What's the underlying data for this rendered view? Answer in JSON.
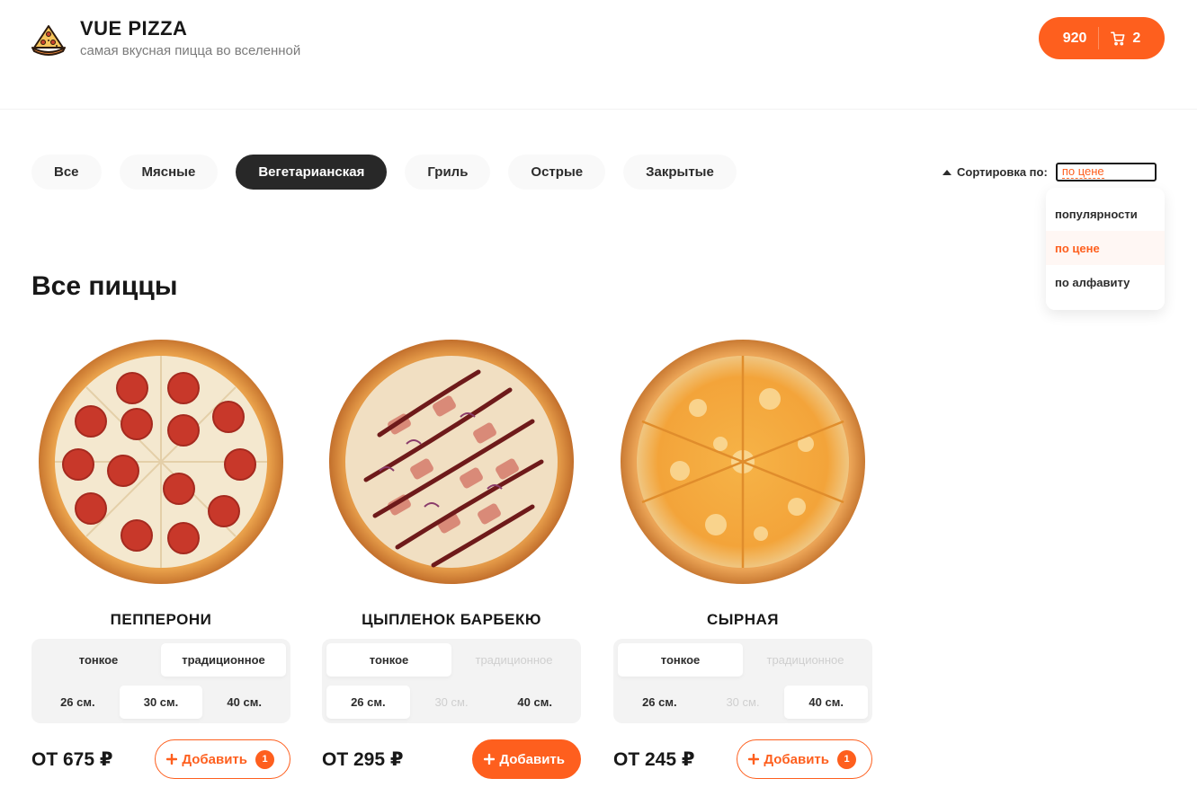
{
  "header": {
    "title": "VUE PIZZA",
    "subtitle": "самая вкусная пицца во вселенной",
    "cart": {
      "sum": "920",
      "count": "2"
    }
  },
  "categories": [
    "Все",
    "Мясные",
    "Вегетарианская",
    "Гриль",
    "Острые",
    "Закрытые"
  ],
  "active_category": "Вегетарианская",
  "sort": {
    "label": "Сортировка по:",
    "value": "по цене",
    "options": [
      "популярности",
      "по цене",
      "по алфавиту"
    ]
  },
  "section_title": "Все пиццы",
  "pizzas": [
    {
      "name": "ПЕППЕРОНИ",
      "types": [
        "тонкое",
        "традиционное"
      ],
      "sizes": [
        "26 см.",
        "30 см.",
        "40 см."
      ],
      "price": "ОТ 675 ₽",
      "add_label": "Добавить",
      "count": "1"
    },
    {
      "name": "ЦЫПЛЕНОК БАРБЕКЮ",
      "types": [
        "тонкое",
        "традиционное"
      ],
      "sizes": [
        "26 см.",
        "30 см.",
        "40 см."
      ],
      "price": "ОТ 295 ₽",
      "add_label": "Добавить",
      "count": ""
    },
    {
      "name": "СЫРНАЯ",
      "types": [
        "тонкое",
        "традиционное"
      ],
      "sizes": [
        "26 см.",
        "30 см.",
        "40 см."
      ],
      "price": "ОТ 245 ₽",
      "add_label": "Добавить",
      "count": "1"
    }
  ],
  "colors": {
    "accent": "#fe5f1e",
    "dark": "#282828"
  }
}
